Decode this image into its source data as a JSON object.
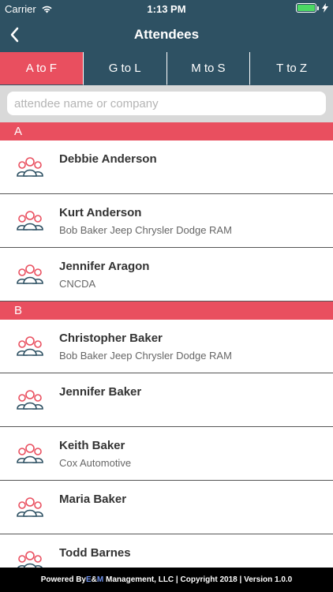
{
  "status": {
    "carrier": "Carrier",
    "time": "1:13 PM"
  },
  "nav": {
    "title": "Attendees"
  },
  "tabs": [
    {
      "label": "A to F",
      "active": true
    },
    {
      "label": "G to L",
      "active": false
    },
    {
      "label": "M to S",
      "active": false
    },
    {
      "label": "T to Z",
      "active": false
    }
  ],
  "search": {
    "placeholder": "attendee name or company",
    "value": ""
  },
  "sections": [
    {
      "letter": "A",
      "attendees": [
        {
          "name": "Debbie Anderson",
          "company": ""
        },
        {
          "name": "Kurt Anderson",
          "company": "Bob Baker Jeep Chrysler Dodge RAM"
        },
        {
          "name": "Jennifer Aragon",
          "company": "CNCDA"
        }
      ]
    },
    {
      "letter": "B",
      "attendees": [
        {
          "name": "Christopher Baker",
          "company": "Bob Baker Jeep Chrysler Dodge RAM"
        },
        {
          "name": "Jennifer Baker",
          "company": ""
        },
        {
          "name": "Keith Baker",
          "company": "Cox Automotive"
        },
        {
          "name": "Maria Baker",
          "company": ""
        },
        {
          "name": "Todd Barnes",
          "company": ""
        }
      ]
    }
  ],
  "footer": {
    "powered_by": "Powered By ",
    "brand_e": "E",
    "brand_amp": "&",
    "brand_m": "M",
    "rest": " Management, LLC | Copyright 2018 | Version 1.0.0"
  },
  "colors": {
    "header": "#2e5163",
    "accent": "#e94f5f"
  }
}
